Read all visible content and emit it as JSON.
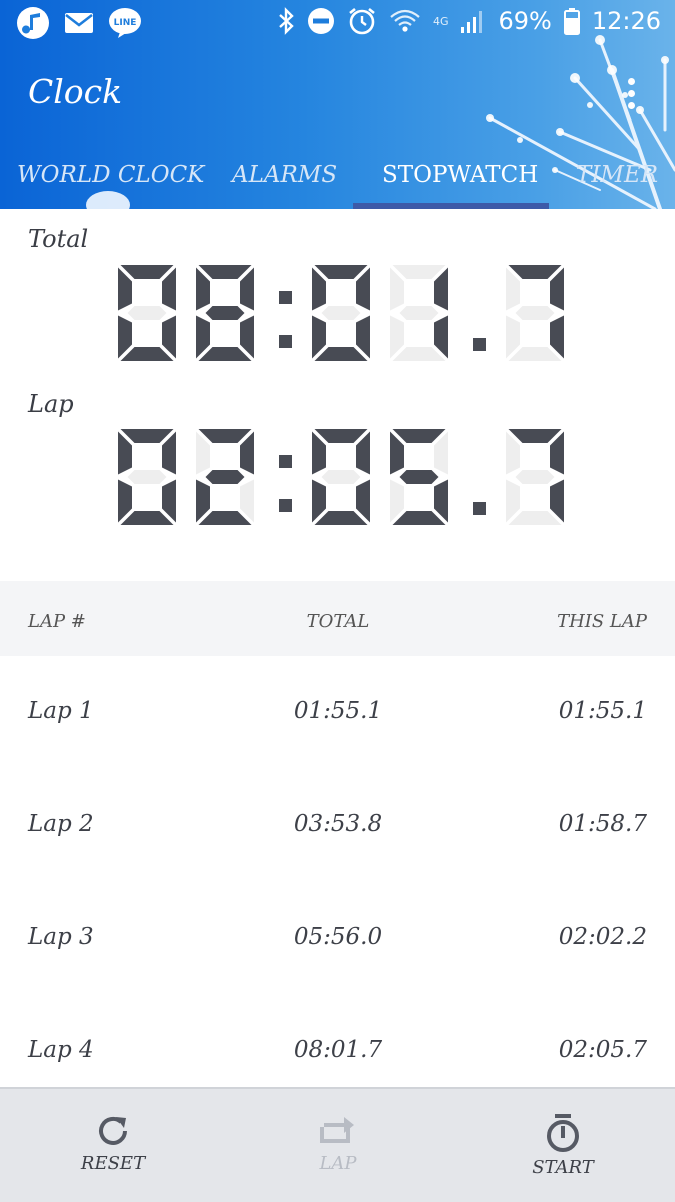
{
  "statusbar": {
    "left_icons": [
      "music-app-icon",
      "mail-icon",
      "line-app-icon"
    ],
    "right_icons": [
      "bluetooth-icon",
      "do-not-disturb-icon",
      "alarm-icon",
      "wifi-icon",
      "signal-icon",
      "battery-icon"
    ],
    "network": "4G",
    "battery": "69%",
    "time": "12:26"
  },
  "appbar": {
    "title": "Clock"
  },
  "tabs": [
    {
      "label": "WORLD CLOCK",
      "active": false
    },
    {
      "label": "ALARMS",
      "active": false
    },
    {
      "label": "STOPWATCH",
      "active": true
    },
    {
      "label": "TIMER",
      "active": false
    }
  ],
  "stopwatch": {
    "total_label": "Total",
    "total_value": "08:01.7",
    "lap_label": "Lap",
    "lap_value": "02:05.7"
  },
  "lap_table": {
    "headers": [
      "LAP #",
      "TOTAL",
      "THIS LAP"
    ],
    "rows": [
      {
        "lap": "Lap 1",
        "total": "01:55.1",
        "this_lap": "01:55.1"
      },
      {
        "lap": "Lap 2",
        "total": "03:53.8",
        "this_lap": "01:58.7"
      },
      {
        "lap": "Lap 3",
        "total": "05:56.0",
        "this_lap": "02:02.2"
      },
      {
        "lap": "Lap 4",
        "total": "08:01.7",
        "this_lap": "02:05.7"
      }
    ]
  },
  "bottom_bar": {
    "reset": {
      "label": "RESET",
      "icon": "reset-icon"
    },
    "lap": {
      "label": "LAP",
      "icon": "lap-icon",
      "enabled": false
    },
    "start": {
      "label": "START",
      "icon": "stopwatch-icon"
    }
  },
  "colors": {
    "header_blue": "#1e7ddc",
    "tab_indicator": "#3d5aa8",
    "segment_on": "#484b54",
    "segment_off": "#eeeeee",
    "bottom_bar": "#e4e6ea"
  }
}
